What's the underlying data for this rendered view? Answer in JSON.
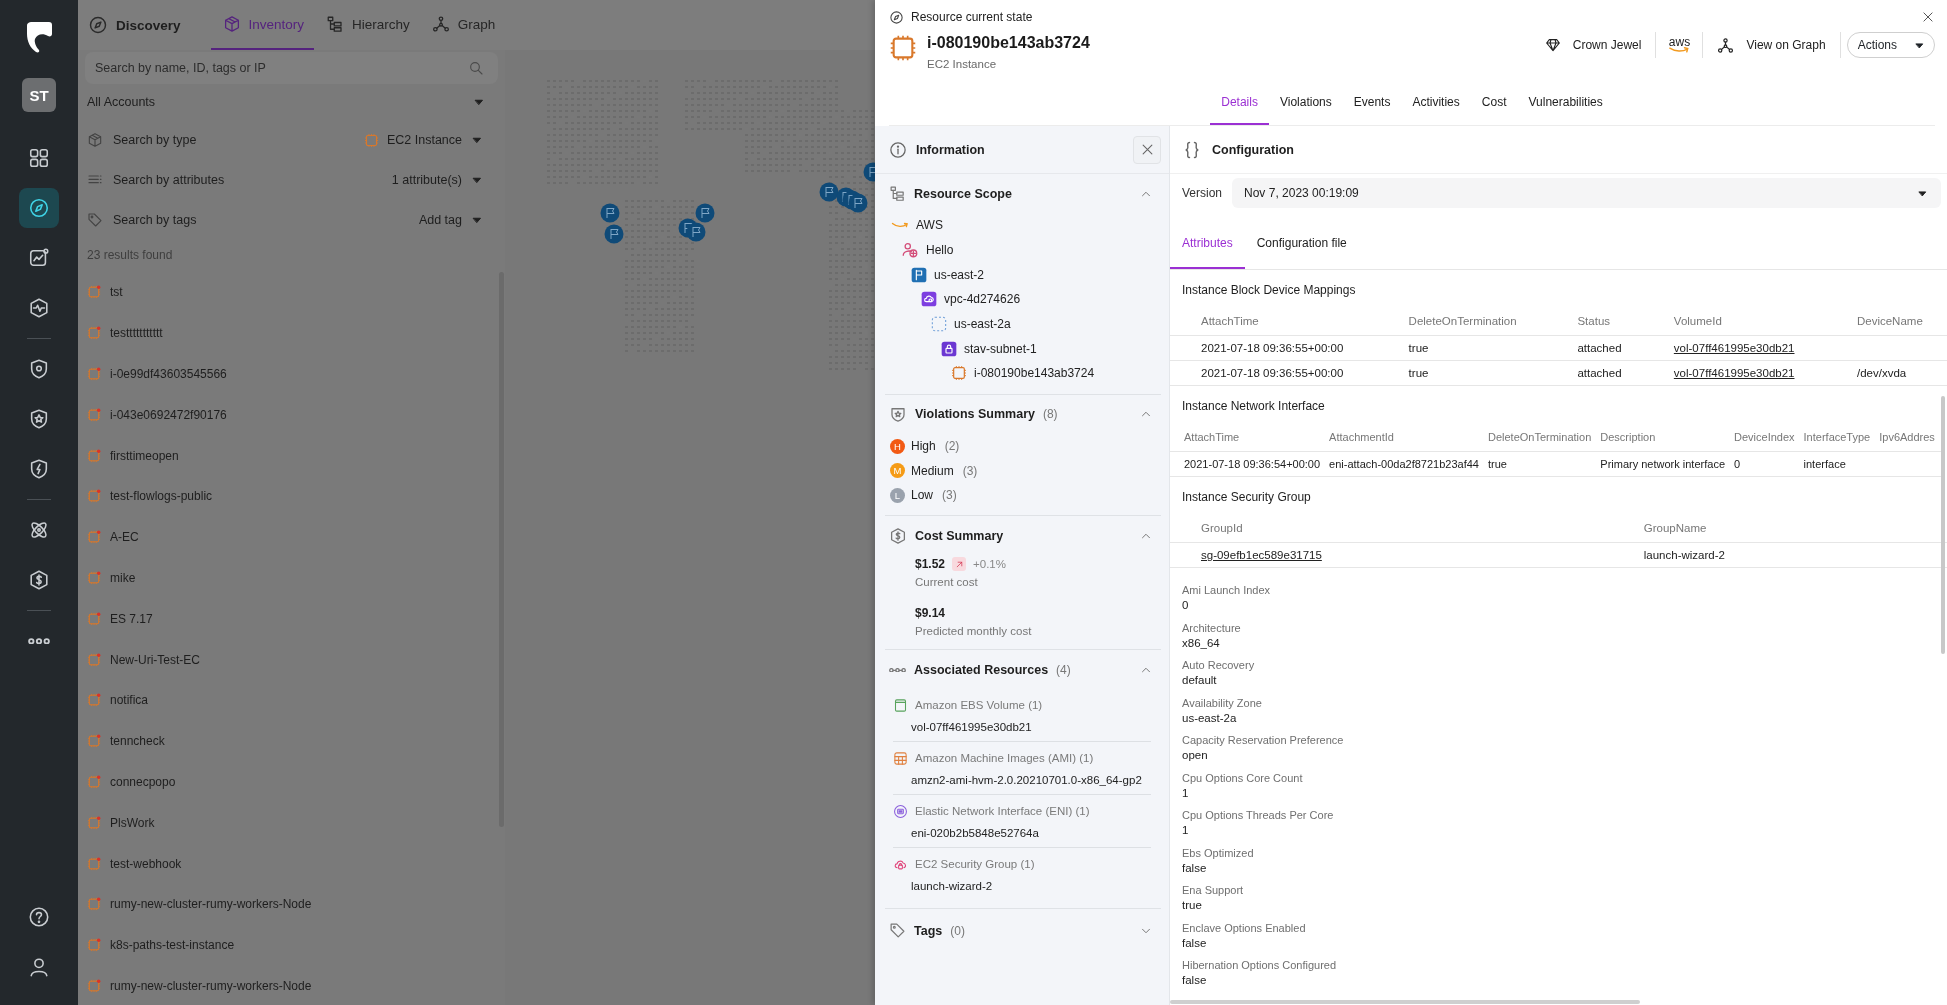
{
  "sidebar": {
    "avatar": "ST",
    "items": [
      {
        "kind": "grid",
        "selected": false
      },
      {
        "kind": "compass",
        "selected": true
      },
      {
        "kind": "chart",
        "selected": false
      },
      {
        "kind": "pulse",
        "selected": false
      },
      {
        "kind": "shield-gear",
        "selected": false
      },
      {
        "kind": "shield-star",
        "selected": false
      },
      {
        "kind": "shield-bolt",
        "selected": false
      },
      {
        "kind": "atom",
        "selected": false
      },
      {
        "kind": "dollar",
        "selected": false
      },
      {
        "kind": "more",
        "selected": false
      }
    ],
    "bottom_items": [
      {
        "kind": "help"
      },
      {
        "kind": "user"
      }
    ]
  },
  "page_title": "Discovery",
  "tabs": [
    {
      "label": "Inventory",
      "kind": "cube",
      "selected": true
    },
    {
      "label": "Hierarchy",
      "kind": "hierarchy",
      "selected": false
    },
    {
      "label": "Graph",
      "kind": "graph",
      "selected": false
    }
  ],
  "search": {
    "placeholder": "Search by name, ID, tags or IP"
  },
  "account_filter": "All Accounts",
  "filters": [
    {
      "kind": "type",
      "label": "Search by type",
      "value": "EC2 Instance"
    },
    {
      "kind": "attributes",
      "label": "Search by attributes",
      "value": "1 attribute(s)"
    },
    {
      "kind": "tags",
      "label": "Search by tags",
      "value": "Add tag"
    }
  ],
  "results_count": "23 results found",
  "results": [
    "tst",
    "testtttttttttt",
    "i-0e99df43603545566",
    "i-043e0692472f90176",
    "firsttimeopen",
    "test-flowlogs-public",
    "A-EC",
    "mike",
    "ES 7.17",
    "New-Uri-Test-EC",
    "notifica",
    "tenncheck",
    "connecpopo",
    "PlsWork",
    "test-webhook",
    "rumy-new-cluster-rumy-workers-Node",
    "k8s-paths-test-instance",
    "rumy-new-cluster-rumy-workers-Node"
  ],
  "drawer": {
    "caption": "Resource current state",
    "title": "i-080190be143ab3724",
    "subtitle": "EC2 Instance",
    "crown_jewel": "Crown Jewel",
    "cloud_logo": "aws",
    "view_on_graph": "View on Graph",
    "actions": "Actions",
    "tabs": [
      {
        "label": "Details",
        "selected": true
      },
      {
        "label": "Violations",
        "selected": false
      },
      {
        "label": "Events",
        "selected": false
      },
      {
        "label": "Activities",
        "selected": false
      },
      {
        "label": "Cost",
        "selected": false
      },
      {
        "label": "Vulnerabilities",
        "selected": false
      }
    ],
    "info": {
      "title": "Information",
      "scope": {
        "title": "Resource Scope",
        "expanded": true,
        "tree": [
          {
            "kind": "aws",
            "label": "AWS",
            "children": [
              {
                "kind": "account",
                "label": "Hello",
                "children": [
                  {
                    "kind": "region",
                    "label": "us-east-2",
                    "children": [
                      {
                        "kind": "vpc",
                        "label": "vpc-4d274626",
                        "children": [
                          {
                            "kind": "zone",
                            "label": "us-east-2a",
                            "children": [
                              {
                                "kind": "subnet",
                                "label": "stav-subnet-1",
                                "children": [
                                  {
                                    "kind": "instance",
                                    "label": "i-080190be143ab3724"
                                  }
                                ]
                              }
                            ]
                          }
                        ]
                      }
                    ]
                  }
                ]
              }
            ]
          }
        ]
      },
      "violations": {
        "title": "Violations Summary",
        "count": "(8)",
        "expanded": true,
        "items": [
          {
            "letter": "H",
            "label": "High",
            "count": "(2)",
            "color": "#f25a14"
          },
          {
            "letter": "M",
            "label": "Medium",
            "count": "(3)",
            "color": "#f59b16"
          },
          {
            "letter": "L",
            "label": "Low",
            "count": "(3)",
            "color": "#9aa2ad"
          }
        ]
      },
      "cost": {
        "title": "Cost Summary",
        "expanded": true,
        "current": "$1.52",
        "trend": "+0.1%",
        "current_label": "Current cost",
        "predicted": "$9.14",
        "predicted_label": "Predicted monthly cost"
      },
      "associated": {
        "title": "Associated Resources",
        "count": "(4)",
        "expanded": true,
        "groups": [
          {
            "kind": "volume",
            "type": "Amazon EBS Volume (1)",
            "value": "vol-07ff461995e30db21"
          },
          {
            "kind": "ami",
            "type": "Amazon Machine Images (AMI) (1)",
            "value": "amzn2-ami-hvm-2.0.20210701.0-x86_64-gp2"
          },
          {
            "kind": "eni",
            "type": "Elastic Network Interface (ENI) (1)",
            "value": "eni-020b2b5848e52764a"
          },
          {
            "kind": "sg",
            "type": "EC2 Security Group (1)",
            "value": "launch-wizard-2"
          }
        ]
      },
      "tags": {
        "title": "Tags",
        "count": "(0)",
        "expanded": false
      }
    },
    "config": {
      "title": "Configuration",
      "version_label": "Version",
      "version": "Nov 7, 2023 00:19:09",
      "tabs": [
        {
          "label": "Attributes",
          "selected": true
        },
        {
          "label": "Configuration file",
          "selected": false
        }
      ],
      "tables": [
        {
          "title": "Instance Block Device Mappings",
          "columns": [
            "AttachTime",
            "DeleteOnTermination",
            "Status",
            "VolumeId",
            "DeviceName"
          ],
          "rows": [
            [
              "2021-07-18 09:36:55+00:00",
              "true",
              "attached",
              {
                "text": "vol-07ff461995e30db21",
                "link": true
              },
              null
            ],
            [
              "2021-07-18 09:36:55+00:00",
              "true",
              "attached",
              {
                "text": "vol-07ff461995e30db21",
                "link": true
              },
              "/dev/xvda"
            ]
          ]
        },
        {
          "title": "Instance Network Interface",
          "columns": [
            "AttachTime",
            "AttachmentId",
            "DeleteOnTermination",
            "Description",
            "DeviceIndex",
            "InterfaceType",
            "Ipv6Addres"
          ],
          "rows": [
            [
              "2021-07-18 09:36:54+00:00",
              "eni-attach-00da2f8721b23af44",
              "true",
              "Primary network interface",
              "0",
              "interface",
              null
            ]
          ]
        },
        {
          "title": "Instance Security Group",
          "columns": [
            "GroupId",
            "GroupName"
          ],
          "rows": [
            [
              {
                "text": "sg-09efb1ec589e31715",
                "link": true
              },
              "launch-wizard-2"
            ]
          ]
        }
      ],
      "attributes": [
        {
          "label": "Ami Launch Index",
          "value": "0"
        },
        {
          "label": "Architecture",
          "value": "x86_64"
        },
        {
          "label": "Auto Recovery",
          "value": "default"
        },
        {
          "label": "Availability Zone",
          "value": "us-east-2a"
        },
        {
          "label": "Capacity Reservation Preference",
          "value": "open"
        },
        {
          "label": "Cpu Options Core Count",
          "value": "1"
        },
        {
          "label": "Cpu Options Threads Per Core",
          "value": "1"
        },
        {
          "label": "Ebs Optimized",
          "value": "false"
        },
        {
          "label": "Ena Support",
          "value": "true"
        },
        {
          "label": "Enclave Options Enabled",
          "value": "false"
        },
        {
          "label": "Hibernation Options Configured",
          "value": "false"
        }
      ]
    }
  }
}
